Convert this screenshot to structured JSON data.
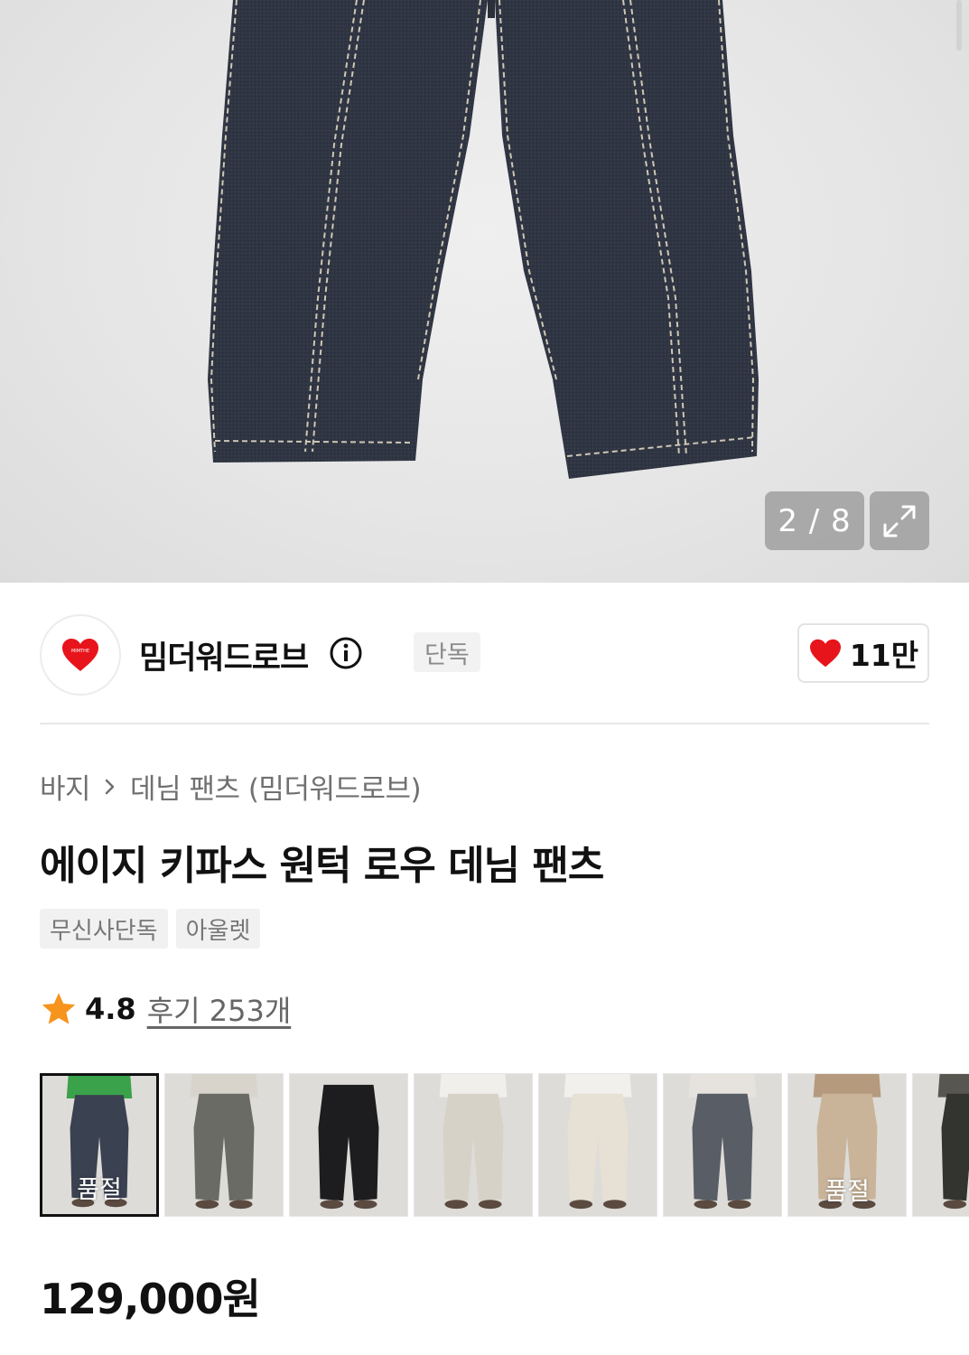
{
  "gallery": {
    "counter": "2 / 8",
    "expand_icon": "expand-arrows-icon"
  },
  "brand": {
    "logo_text": "MIMTHE",
    "name": "밈더워드로브",
    "badge": "단독",
    "like_count": "11만",
    "heart_color": "#e8141c"
  },
  "breadcrumb": {
    "category": "바지",
    "subcategory": "데님 팬츠 (밈더워드로브)"
  },
  "product": {
    "title": "에이지 키파스 원턱 로우 데님 팬츠",
    "tags": [
      "무신사단독",
      "아울렛"
    ],
    "rating": "4.8",
    "reviews": "후기 253개",
    "star_color": "#f7941d",
    "price": "129,000원"
  },
  "thumbnails": [
    {
      "color": "#3a4150",
      "soldout": "품절",
      "top_color": "#3aa24a"
    },
    {
      "color": "#6b6b66",
      "soldout": "",
      "top_color": "#d8d4cc"
    },
    {
      "color": "#1d1d1f",
      "soldout": "",
      "top_color": ""
    },
    {
      "color": "#d6d2c8",
      "soldout": "",
      "top_color": "#f0efec"
    },
    {
      "color": "#e7e1d5",
      "soldout": "",
      "top_color": "#f2f0ec"
    },
    {
      "color": "#595d66",
      "soldout": "",
      "top_color": "#e6e3de"
    },
    {
      "color": "#c9b49a",
      "soldout": "품절",
      "top_color": "#b59a7e"
    },
    {
      "color": "#33332f",
      "soldout": "품",
      "top_color": "#585650"
    }
  ]
}
